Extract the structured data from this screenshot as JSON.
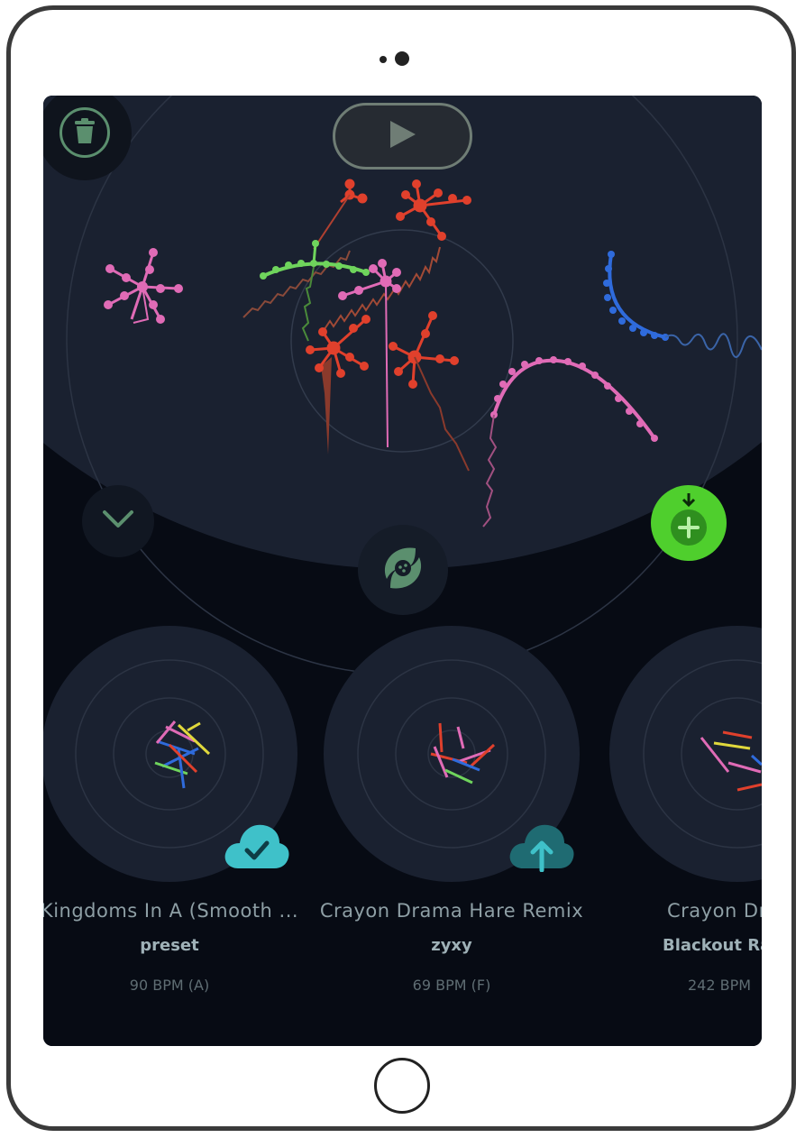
{
  "app": {
    "accent_green": "#4fcf2d",
    "icon_green": "#5b8f6e"
  },
  "toolbar": {
    "trash_icon": "trash-icon",
    "play_icon": "play-icon",
    "collapse_icon": "chevron-down-icon",
    "logo_icon": "app-logo-icon",
    "add_icon": "download-plus-icon"
  },
  "presets": [
    {
      "title": "Kingdoms In A (Smooth ...",
      "author": "preset",
      "bpm": "90 BPM (A)",
      "cloud_state": "synced",
      "cloud_icon": "cloud-check-icon"
    },
    {
      "title": "Crayon Drama Hare Remix",
      "author": "zyxy",
      "bpm": "69 BPM (F)",
      "cloud_state": "upload",
      "cloud_icon": "cloud-upload-icon"
    },
    {
      "title": "Crayon Dr",
      "author": "Blackout Ra",
      "bpm": "242 BPM",
      "cloud_state": "none",
      "cloud_icon": ""
    }
  ]
}
